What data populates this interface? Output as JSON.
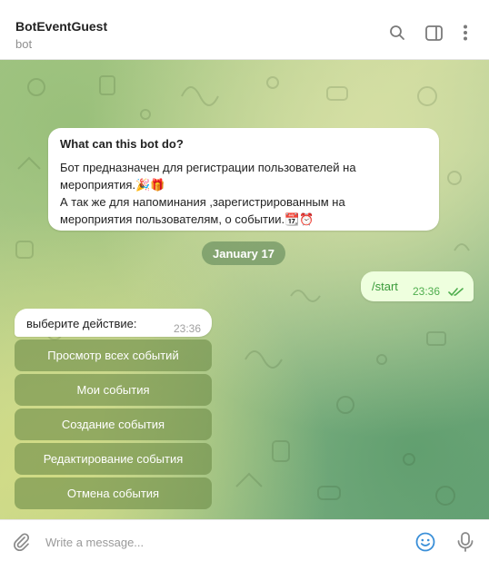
{
  "header": {
    "title": "BotEventGuest",
    "subtitle": "bot",
    "icons": [
      "search-icon",
      "sidebar-toggle-icon",
      "more-vertical-icon"
    ]
  },
  "info_card": {
    "title": "What can this bot do?",
    "lines": [
      "Бот предназначен для регистрации пользователей на",
      "мероприятия.🎉🎁",
      "А так же для напоминания ,зарегистрированным на",
      "мероприятия пользователям, о событии.📆⏰"
    ]
  },
  "date_separator": "January 17",
  "outgoing_message": {
    "text": "/start",
    "time": "23:36",
    "status": "read"
  },
  "incoming_message": {
    "text": "выберите действие:",
    "time": "23:36"
  },
  "keyboard": [
    "Просмотр всех событий",
    "Мои события",
    "Создание события",
    "Редактирование события",
    "Отмена события"
  ],
  "composer": {
    "placeholder": "Write a message...",
    "value": ""
  },
  "colors": {
    "outgoing_bubble": "#eeffde",
    "outgoing_accent": "#4fae4e",
    "keyboard_button": "#6e8c48",
    "icon_blue": "#3a8fd8"
  }
}
